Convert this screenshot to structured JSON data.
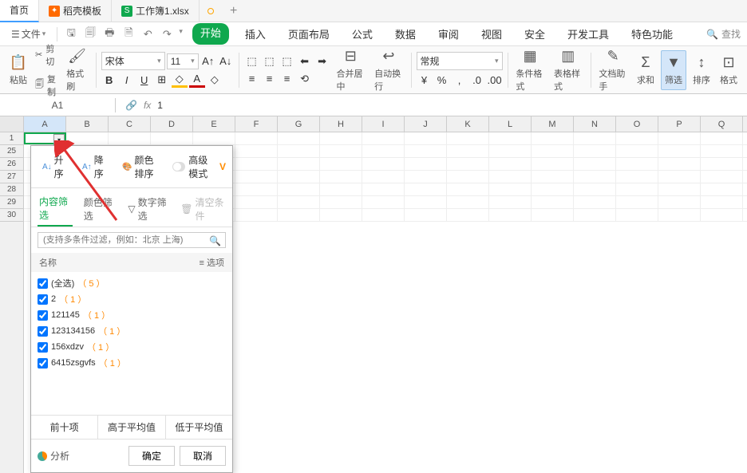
{
  "tabs": {
    "home": "首页",
    "template": "稻壳模板",
    "workbook": "工作簿1.xlsx"
  },
  "menu": {
    "file": "文件",
    "search": "查找"
  },
  "ribbon_tabs": [
    "开始",
    "插入",
    "页面布局",
    "公式",
    "数据",
    "审阅",
    "视图",
    "安全",
    "开发工具",
    "特色功能"
  ],
  "ribbon": {
    "paste": "粘贴",
    "cut": "剪切",
    "copy": "复制",
    "format_painter": "格式刷",
    "font_name": "宋体",
    "font_size": "11",
    "number_format": "常规",
    "merge_center": "合并居中",
    "auto_wrap": "自动换行",
    "cond_format": "条件格式",
    "table_style": "表格样式",
    "doc_assist": "文档助手",
    "sum": "求和",
    "filter": "筛选",
    "sort": "排序",
    "format": "格式"
  },
  "name_box": "A1",
  "formula_value": "1",
  "columns": [
    "A",
    "B",
    "C",
    "D",
    "E",
    "F",
    "G",
    "H",
    "I",
    "J",
    "K",
    "L",
    "M",
    "N",
    "O",
    "P",
    "Q"
  ],
  "visible_rows": [
    "1",
    "25",
    "26",
    "27",
    "28",
    "29",
    "30"
  ],
  "filter_panel": {
    "sort_asc": "升序",
    "sort_desc": "降序",
    "color_sort": "颜色排序",
    "adv_mode": "高级模式",
    "tab_content": "内容筛选",
    "tab_color": "颜色筛选",
    "tab_number": "数字筛选",
    "clear": "清空条件",
    "search_placeholder": "(支持多条件过滤，例如：北京 上海)",
    "col_name": "名称",
    "col_options": "选项",
    "items": [
      {
        "label": "(全选)",
        "count": "5"
      },
      {
        "label": "2",
        "count": "1"
      },
      {
        "label": "121145",
        "count": "1"
      },
      {
        "label": "123134156",
        "count": "1"
      },
      {
        "label": "156xdzv",
        "count": "1"
      },
      {
        "label": "6415zsgvfs",
        "count": "1"
      }
    ],
    "quick": [
      "前十项",
      "高于平均值",
      "低于平均值"
    ],
    "analyze": "分析",
    "ok": "确定",
    "cancel": "取消"
  }
}
